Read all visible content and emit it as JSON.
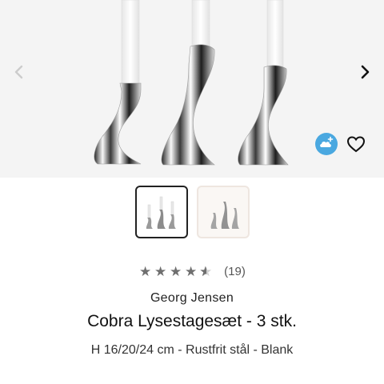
{
  "product": {
    "rating": {
      "value": 4.5,
      "max": 5,
      "count_label": "(19)"
    },
    "brand": "Georg Jensen",
    "title": "Cobra Lysestagesæt - 3 stk.",
    "subtitle": "H 16/20/24 cm - Rustfrit stål - Blank"
  },
  "gallery": {
    "images": [
      "cobra-candleholders-with-candles",
      "cobra-candleholders-without-candles"
    ],
    "selected_index": 0,
    "icons": {
      "prev": "chevron-left-icon",
      "next": "chevron-right-icon",
      "cloud": "cloud-plus-icon",
      "wishlist": "heart-outline-icon"
    }
  },
  "colors": {
    "cloud_badge": "#4aa8e0",
    "star": "#6f6f6f",
    "thumb_selected_border": "#222222"
  }
}
